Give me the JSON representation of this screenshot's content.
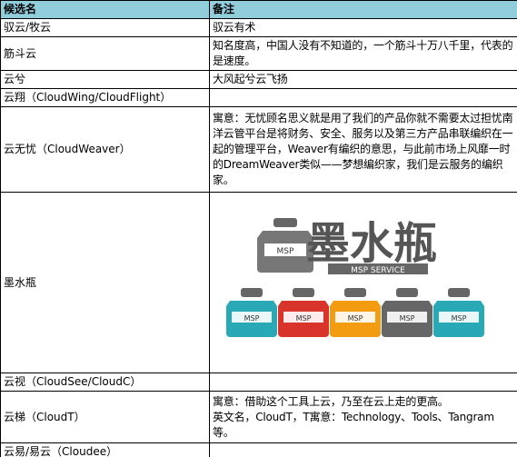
{
  "headers": {
    "name": "候选名",
    "note": "备注"
  },
  "rows": [
    {
      "name": "驭云/牧云",
      "note": "驭云有术"
    },
    {
      "name": "筋斗云",
      "note": "知名度高，中国人没有不知道的，一个筋斗十万八千里，代表的是速度。"
    },
    {
      "name": "云兮",
      "note": "大风起兮云飞扬"
    },
    {
      "name": "云翔（CloudWing/CloudFlight）",
      "note": ""
    },
    {
      "name": "云无忧（CloudWeaver）",
      "note": "寓意：无忧顾名思义就是用了我们的产品你就不需要太过担忧南洋云管平台是将财务、安全、服务以及第三方产品串联编织在一起的管理平台，Weaver有编织的意思，与此前市场上风靡一时的DreamWeaver类似——梦想编织家，我们是云服务的编织家。"
    },
    {
      "name": "墨水瓶",
      "logo": {
        "title": "墨水瓶",
        "subtitle": "MSP SERVICE",
        "bottle_label": "MSP",
        "bottle_colors": [
          "#29a8b6",
          "#d9342b",
          "#f39c12",
          "#666666",
          "#29a8b6"
        ]
      }
    },
    {
      "name": "云视（CloudSee/CloudC）",
      "note": ""
    },
    {
      "name": "云梯（CloudT）",
      "note": "寓意：借助这个工具上云，乃至在云上走的更高。",
      "note2": "英文名，CloudT，T寓意：Technology、Tools、Tangram等。"
    },
    {
      "name": "云易/易云（Cloudee）",
      "note": ""
    }
  ]
}
